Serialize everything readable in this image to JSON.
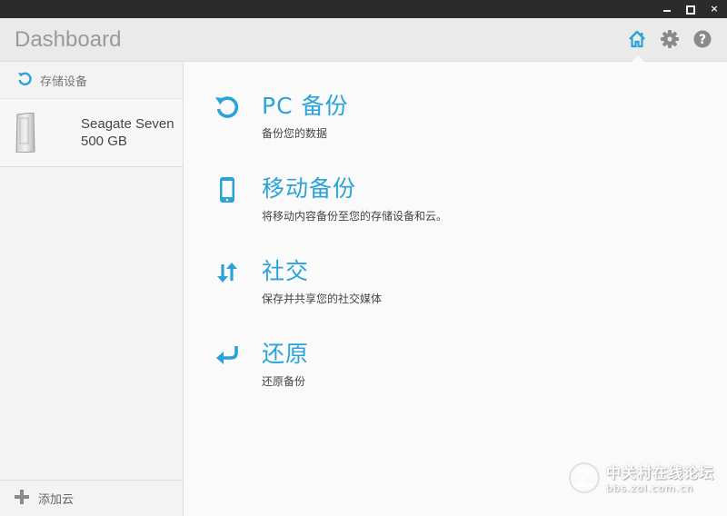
{
  "window": {
    "controls": {
      "minimize": "minimize",
      "maximize": "maximize",
      "close": "×"
    }
  },
  "header": {
    "title": "Dashboard",
    "icons": [
      "home-icon",
      "gear-icon",
      "help-icon"
    ]
  },
  "sidebar": {
    "section_label": "存储设备",
    "devices": [
      {
        "name": "Seagate Seven",
        "capacity": "500 GB"
      }
    ],
    "add_cloud_label": "添加云"
  },
  "main": {
    "actions": [
      {
        "title": "PC 备份",
        "desc": "备份您的数据",
        "icon": "pc-backup-icon"
      },
      {
        "title": "移动备份",
        "desc": "将移动内容备份至您的存储设备和云。",
        "icon": "mobile-icon"
      },
      {
        "title": "社交",
        "desc": "保存并共享您的社交媒体",
        "icon": "social-arrows-icon"
      },
      {
        "title": "还原",
        "desc": "还原备份",
        "icon": "restore-icon"
      }
    ]
  },
  "watermark": {
    "main": "中关村在线论坛",
    "sub": "bbs.zol.com.cn"
  },
  "colors": {
    "accent": "#2aa3d8",
    "titlebar": "#2b2b2b",
    "header_bg": "#eaeaea",
    "main_bg": "#fafafa"
  }
}
